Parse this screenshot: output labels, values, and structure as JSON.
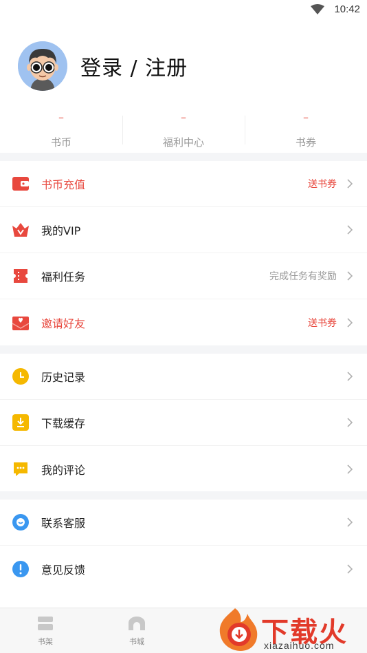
{
  "status_bar": {
    "time": "10:42"
  },
  "profile": {
    "login_label": "登录 / 注册"
  },
  "stats": [
    {
      "value": "–",
      "label": "书币"
    },
    {
      "value": "–",
      "label": "福利中心"
    },
    {
      "value": "–",
      "label": "书券"
    }
  ],
  "menu_groups": [
    [
      {
        "icon": "wallet-icon",
        "label": "书币充值",
        "extra": "送书券",
        "highlight": true,
        "color": "#e8483e"
      },
      {
        "icon": "vip-crown-icon",
        "label": "我的VIP",
        "extra": "",
        "highlight": false,
        "color": "#e8483e"
      },
      {
        "icon": "ticket-icon",
        "label": "福利任务",
        "extra": "完成任务有奖励",
        "highlight": false,
        "color": "#e8483e"
      },
      {
        "icon": "envelope-heart-icon",
        "label": "邀请好友",
        "extra": "送书券",
        "highlight": true,
        "color": "#e8483e"
      }
    ],
    [
      {
        "icon": "clock-icon",
        "label": "历史记录",
        "extra": "",
        "highlight": false,
        "color": "#f5b800"
      },
      {
        "icon": "download-icon",
        "label": "下载缓存",
        "extra": "",
        "highlight": false,
        "color": "#f5b800"
      },
      {
        "icon": "comment-icon",
        "label": "我的评论",
        "extra": "",
        "highlight": false,
        "color": "#f5b800"
      }
    ],
    [
      {
        "icon": "customer-service-icon",
        "label": "联系客服",
        "extra": "",
        "highlight": false,
        "color": "#3a97f0"
      },
      {
        "icon": "feedback-icon",
        "label": "意见反馈",
        "extra": "",
        "highlight": false,
        "color": "#3a97f0"
      }
    ]
  ],
  "tabbar": {
    "tabs": [
      {
        "label": "书架",
        "icon": "bookshelf-icon"
      },
      {
        "label": "书城",
        "icon": "bookstore-icon"
      }
    ]
  },
  "watermark": {
    "brand": "下载火",
    "url": "xiazaihuo.com"
  }
}
